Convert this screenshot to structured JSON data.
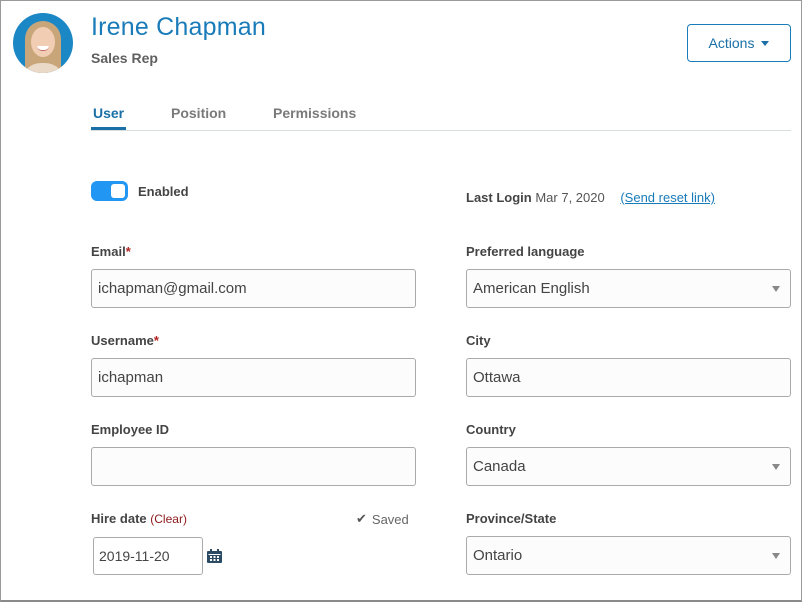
{
  "header": {
    "name": "Irene Chapman",
    "role": "Sales Rep",
    "actions_label": "Actions"
  },
  "tabs": [
    {
      "label": "User",
      "active": true
    },
    {
      "label": "Position",
      "active": false
    },
    {
      "label": "Permissions",
      "active": false
    }
  ],
  "status": {
    "enabled_label": "Enabled",
    "enabled": true
  },
  "last_login": {
    "label": "Last Login",
    "value": "Mar 7, 2020",
    "reset_link": "(Send reset link)"
  },
  "form": {
    "email": {
      "label": "Email",
      "required_mark": "*",
      "value": "ichapman@gmail.com"
    },
    "username": {
      "label": "Username",
      "required_mark": "*",
      "value": "ichapman"
    },
    "employee_id": {
      "label": "Employee ID",
      "value": ""
    },
    "hire_date": {
      "label": "Hire date",
      "clear_label": "(Clear)",
      "value": "2019-11-20",
      "saved_label": "Saved"
    },
    "preferred_language": {
      "label": "Preferred language",
      "value": "American English"
    },
    "city": {
      "label": "City",
      "value": "Ottawa"
    },
    "country": {
      "label": "Country",
      "value": "Canada"
    },
    "province_state": {
      "label": "Province/State",
      "value": "Ontario"
    }
  },
  "colors": {
    "accent": "#1a7bb9",
    "toggle_on": "#2196f3",
    "required": "#b22222",
    "clear_link": "#8b1a1a"
  }
}
